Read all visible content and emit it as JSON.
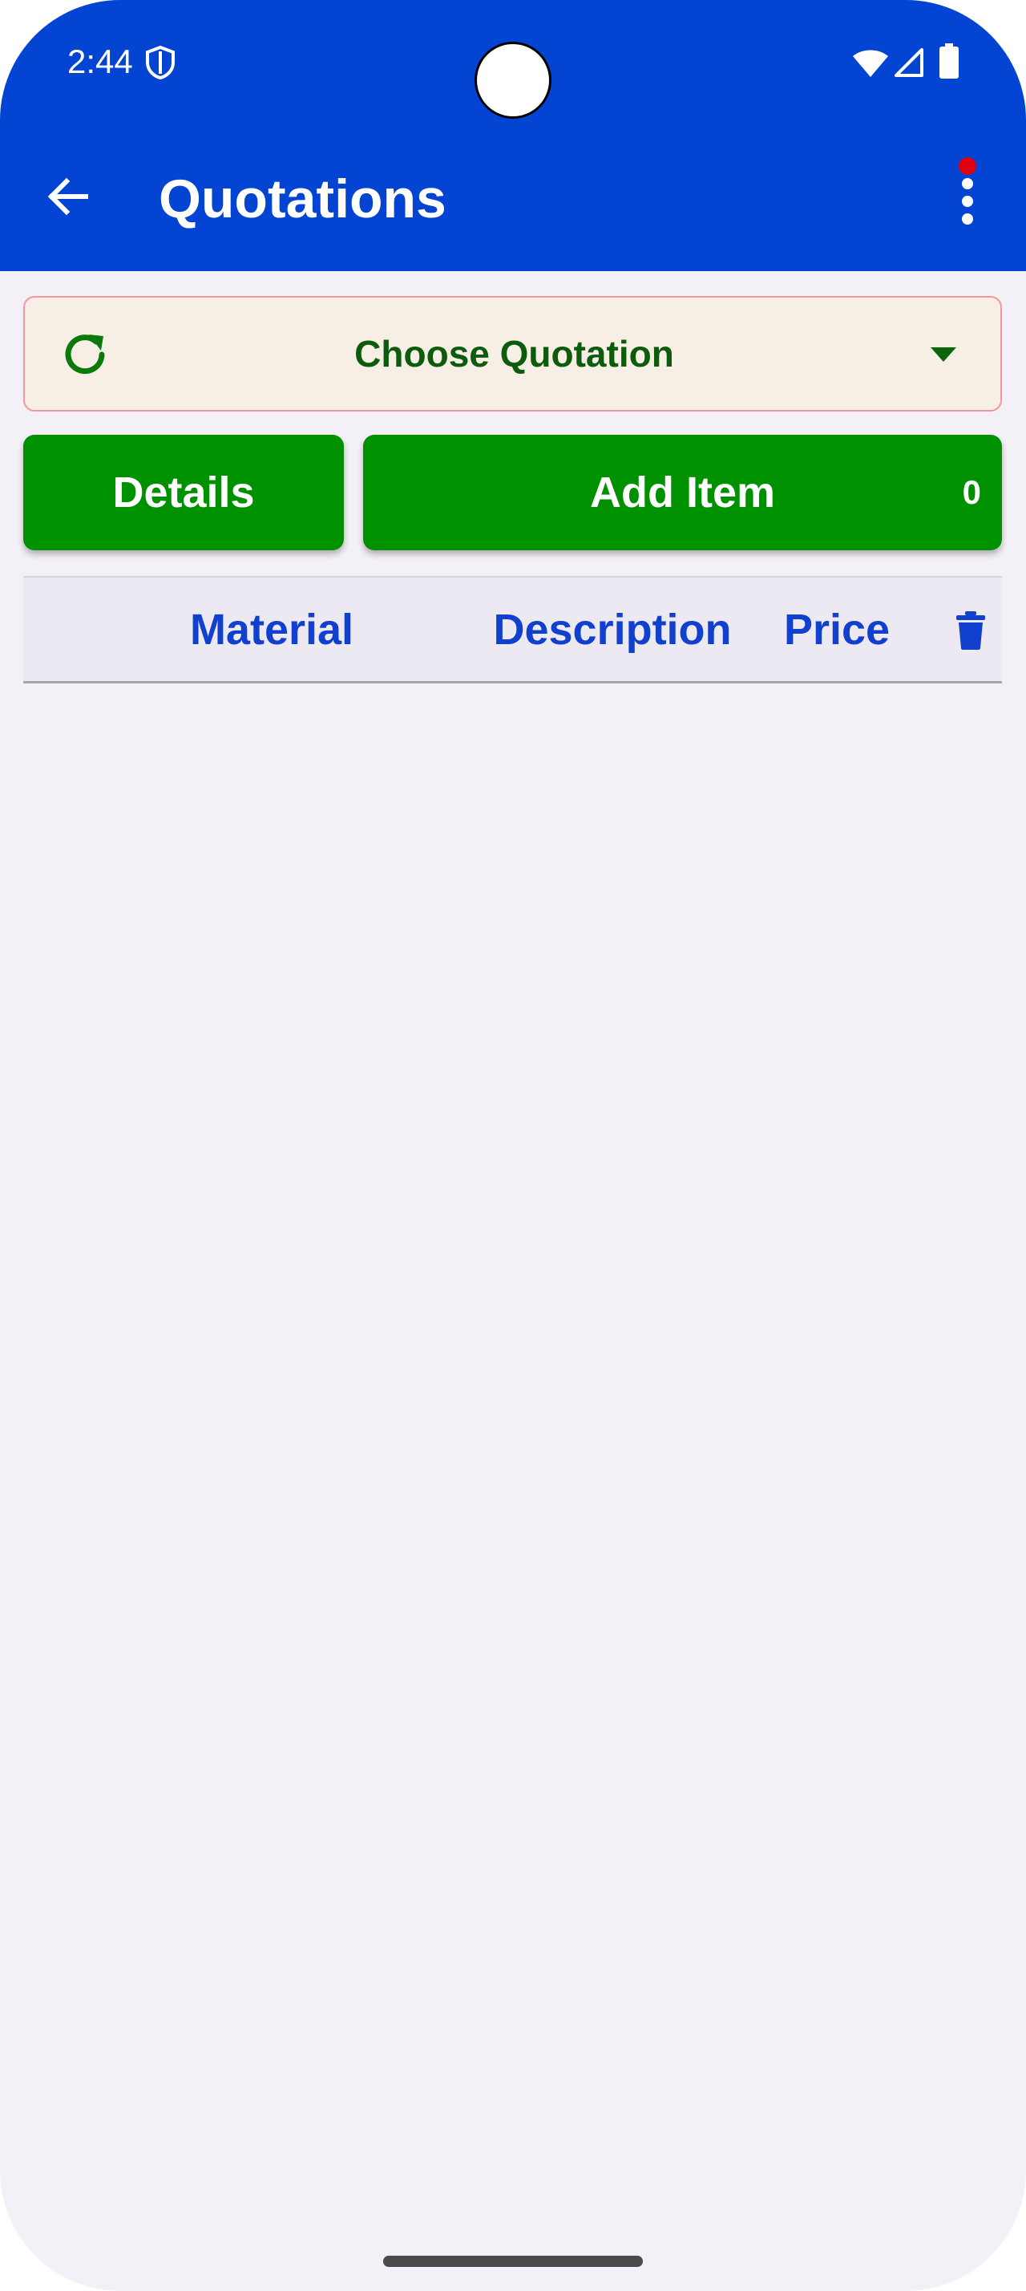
{
  "status_bar": {
    "time": "2:44",
    "icons": [
      "shield-icon",
      "wifi-icon",
      "signal-icon",
      "battery-icon"
    ]
  },
  "toolbar": {
    "title": "Quotations",
    "back_icon": "arrow-left-icon",
    "menu_icon": "more-vertical-icon",
    "notification_dot_color": "#e0000f"
  },
  "quotation_selector": {
    "label": "Choose Quotation",
    "refresh_icon": "refresh-icon",
    "dropdown_icon": "caret-down-icon"
  },
  "actions": {
    "details_label": "Details",
    "add_item_label": "Add Item",
    "item_count": "0"
  },
  "table": {
    "columns": [
      "Material",
      "Description",
      "Price"
    ],
    "delete_icon": "trash-icon",
    "rows": []
  },
  "colors": {
    "app_bar": "#0344d3",
    "button_green": "#009100",
    "header_text": "#1140cf",
    "selector_text": "#0d5c0d",
    "background": "#f4f0f7"
  }
}
